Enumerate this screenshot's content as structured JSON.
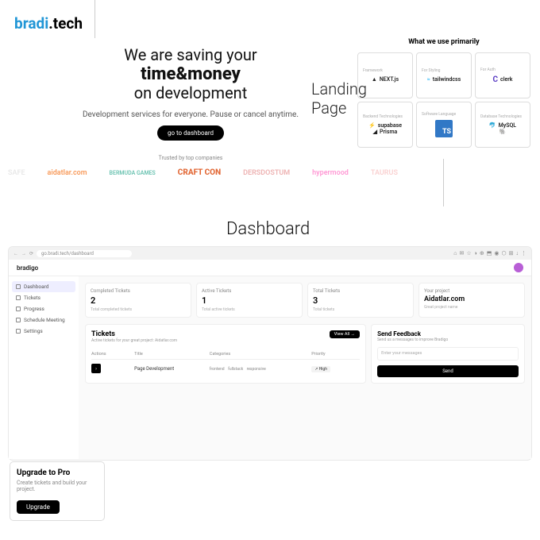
{
  "brand": {
    "part1": "bradi",
    "part2": ".tech"
  },
  "hero": {
    "line1": "We are saving your",
    "line2": "time&money",
    "line3": "on development",
    "sub": "Development services for everyone. Pause or cancel anytime.",
    "button": "go to dashboard",
    "trusted": "Trusted by top companies"
  },
  "landing_label_1": "Landing",
  "landing_label_2": "Page",
  "dashboard_label": "Dashboard",
  "companies": [
    "SAFE",
    "aidatlar.com",
    "BERMUDA GAMES",
    "CRAFT CON",
    "DERSDOSTUM",
    "hypermood",
    "TAURUS"
  ],
  "primarily": {
    "title": "What we use primarily",
    "cells": [
      {
        "h": "Framework",
        "name": "NEXT.js"
      },
      {
        "h": "For Styling",
        "name": "tailwindcss"
      },
      {
        "h": "For Auth",
        "name": "clerk"
      },
      {
        "h": "Backend Technologies",
        "name1": "supabase",
        "name2": "Prisma"
      },
      {
        "h": "Software Language",
        "name": "TS"
      },
      {
        "h": "Database Technologies",
        "name1": "MySQL",
        "name2": "Postgres"
      }
    ]
  },
  "dashboard": {
    "url": "go.bradi.tech/dashboard",
    "app": "bradigo",
    "sidebar": [
      "Dashboard",
      "Tickets",
      "Progress",
      "Schedule Meeting",
      "Settings"
    ],
    "stats": [
      {
        "h": "Completed Tickets",
        "v": "2",
        "s": "Total completed tickets"
      },
      {
        "h": "Active Tickets",
        "v": "1",
        "s": "Total active tickets"
      },
      {
        "h": "Total Tickets",
        "v": "3",
        "s": "Total tickets"
      },
      {
        "h": "Your project",
        "v": "Aidatlar.com",
        "s": "Great project name"
      }
    ],
    "tickets": {
      "title": "Tickets",
      "sub": "Active tickets for your great project: Aidatlar.com",
      "viewall": "View All →",
      "cols": {
        "a": "Actions",
        "t": "Title",
        "c": "Categories",
        "p": "Priority"
      },
      "row": {
        "title": "Page Development",
        "cats": [
          "frontend",
          "fullstack",
          "responsive"
        ],
        "prio": "↗ High"
      }
    },
    "feedback": {
      "title": "Send Feedback",
      "sub": "Send us a messages to improve Bradigo",
      "placeholder": "Enter your messages",
      "send": "Send"
    },
    "upgrade": {
      "title": "Upgrade to Pro",
      "sub": "Create tickets and build your project.",
      "btn": "Upgrade"
    }
  }
}
